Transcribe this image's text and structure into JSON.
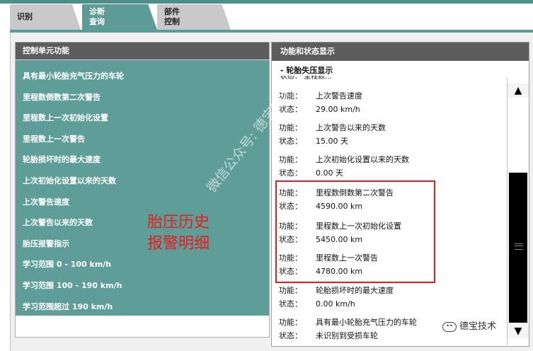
{
  "tabs": [
    {
      "label": "识别"
    },
    {
      "label": "诊断\n查询"
    },
    {
      "label": "部件\n控制"
    }
  ],
  "left_panel": {
    "title": "控制单元功能",
    "items": [
      "具有最小轮胎充气压力的车轮",
      "里程数倒数第二次警告",
      "里程数上一次初始化设置",
      "里程数上一次警告",
      "轮胎损坏时的最大速度",
      "上次初始化设置以来的天数",
      "上次警告速度",
      "上次警告以来的天数",
      "胎压报警指示",
      "学习范围 0 - 100 km/h",
      "学习范围 100 - 190 km/h",
      "学习范围超过 190 km/h"
    ]
  },
  "right_panel": {
    "title": "功能和状态显示",
    "subtitle": "- 轮胎失压显示",
    "cut_line": "状态：  里程数...",
    "label_func": "功能：",
    "label_state": "状态：",
    "entries": [
      {
        "func": "上次警告速度",
        "state": "29.00 km/h"
      },
      {
        "func": "上次警告以来的天数",
        "state": "15.00 天"
      },
      {
        "func": "上次初始化设置以来的天数",
        "state": "0.00 天"
      },
      {
        "func": "里程数倒数第二次警告",
        "state": "4590.00 km"
      },
      {
        "func": "里程数上一次初始化设置",
        "state": "5450.00 km"
      },
      {
        "func": "里程数上一次警告",
        "state": "4780.00 km"
      },
      {
        "func": "轮胎损坏时的最大速度",
        "state": "0.00 km/h"
      },
      {
        "func": "具有最小轮胎充气压力的车轮",
        "state": "未识别到受损车轮"
      }
    ]
  },
  "annotation": {
    "line1": "胎压历史",
    "line2": "报警明细"
  },
  "watermark": "微信公众号: 德宝技术",
  "brand": "德宝技术",
  "colors": {
    "accent": "#5d9b96",
    "highlight": "#e81c1c",
    "header": "#5d5d5d"
  }
}
